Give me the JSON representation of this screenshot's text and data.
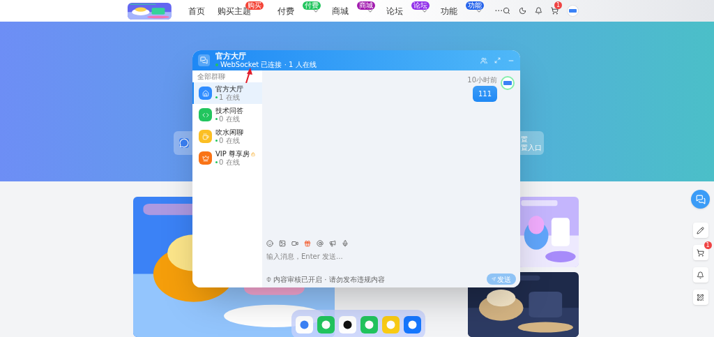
{
  "nav": {
    "items": [
      {
        "label": "首页",
        "dropdown": false
      },
      {
        "label": "购买主题",
        "badge": {
          "text": "购买",
          "color": "#f44336"
        },
        "dropdown": false
      },
      {
        "label": "付费",
        "badge": {
          "text": "付费",
          "color": "#22c55e"
        },
        "dropdown": true
      },
      {
        "label": "商城",
        "badge": {
          "text": "商城",
          "color": "#a21caf"
        },
        "dropdown": true
      },
      {
        "label": "论坛",
        "badge": {
          "text": "论坛",
          "color": "#9333ea"
        },
        "dropdown": true
      },
      {
        "label": "功能",
        "badge": {
          "text": "功能",
          "color": "#2563eb"
        },
        "dropdown": true
      },
      {
        "label": "···",
        "dropdown": false
      }
    ],
    "cart_count": "1"
  },
  "hero_card": {
    "line_1": "置",
    "line_2": "置入口"
  },
  "chat": {
    "title": "官方大厅",
    "status": "WebSocket 已连接 · 1 人在线",
    "connected": true,
    "sidebar_heading": "全部群聊",
    "groups": [
      {
        "kind": "home",
        "name": "官方大厅",
        "online": "1 在线",
        "color": "#2f8cff",
        "selected": true,
        "locked": false
      },
      {
        "kind": "code",
        "name": "技术问答",
        "online": "0 在线",
        "color": "#22c55e",
        "selected": false,
        "locked": false
      },
      {
        "kind": "coffee",
        "name": "吹水闲聊",
        "online": "0 在线",
        "color": "#fbbf24",
        "selected": false,
        "locked": false
      },
      {
        "kind": "crown",
        "name": "VIP 尊享房",
        "online": "0 在线",
        "color": "#f97316",
        "selected": false,
        "locked": true
      }
    ],
    "messages": [
      {
        "time": "10小时前",
        "text": "111"
      }
    ],
    "input": {
      "placeholder": "输入消息，Enter 发送..."
    },
    "notice": "内容审核已开启 · 请勿发布违规内容",
    "send": {
      "label": "发送",
      "disabled": true
    }
  },
  "float_cart_count": "1"
}
